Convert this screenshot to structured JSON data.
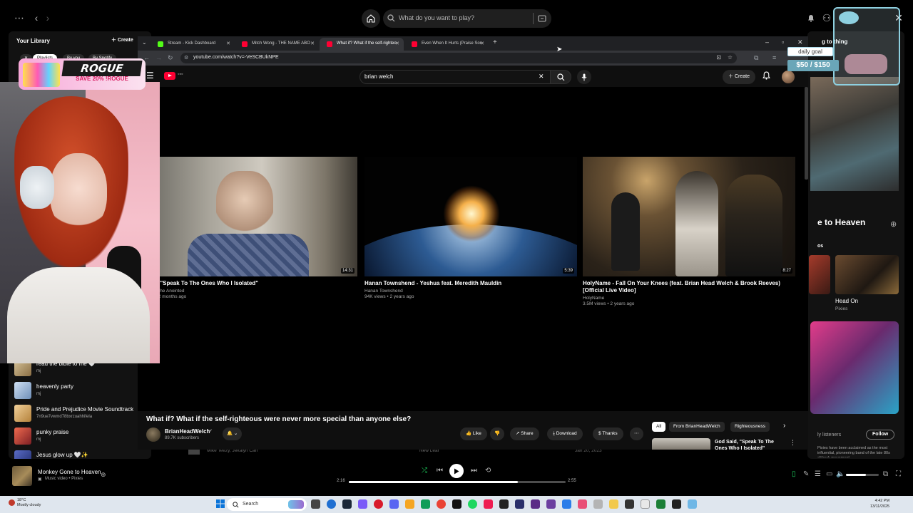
{
  "spotify": {
    "search_placeholder": "What do you want to play?",
    "library": {
      "title": "Your Library",
      "create_label": "Create",
      "chips": [
        "Playlists",
        "By you",
        "By Spotify"
      ],
      "items": [
        {
          "name": "read the bible to me 🤍",
          "sub": "mj"
        },
        {
          "name": "heavenly party",
          "sub": "mj"
        },
        {
          "name": "Pride and Prejudice Movie Soundtrack",
          "sub": "7n9ue7vwmd78bxrzuahhifela"
        },
        {
          "name": "punky praise",
          "sub": "mj"
        },
        {
          "name": "Jesus glow up 🤍✨",
          "sub": ""
        }
      ]
    },
    "right_panel": {
      "header_snippet": "g to thing",
      "song_title": "e to Heaven",
      "section_label": "os",
      "card_title": "Head On",
      "card_artist": "Pixies",
      "listeners_label": "ly listeners",
      "follow_label": "Follow",
      "bio": "Pixies have been acclaimed as the most influential, pioneering band of the late 80s alt/rock movement,"
    },
    "now_playing": {
      "title": "Monkey Gone to Heaven",
      "subtitle": "Music video • Pixies",
      "elapsed": "2:16",
      "duration": "2:55",
      "progress": 0.78,
      "volume": 0.6
    },
    "obscured_row": {
      "artists": "Mike Teezy, Jekalyn Carr",
      "album": "New Lear",
      "date": "Jan 20, 2023"
    }
  },
  "browser": {
    "tabs": [
      {
        "title": "Stream - Kick Dashboard",
        "active": false,
        "color": "#53fc18"
      },
      {
        "title": "Mitch Wong - THE NAME ABO",
        "active": false,
        "color": "#ff0033"
      },
      {
        "title": "What if? What if the self-righteo",
        "active": true,
        "color": "#ff0033"
      },
      {
        "title": "Even When It Hurts (Praise Son",
        "active": false,
        "color": "#ff0033"
      }
    ],
    "url": "youtube.com/watch?v=-VeSCBUkNPE"
  },
  "youtube": {
    "search_value": "brian welch",
    "create_label": "Create",
    "end_cards": [
      {
        "title": "Said, \"Speak To The Ones Who I Isolated\"",
        "channel": "ey Of The Anointed",
        "meta": "iews • 2 months ago",
        "duration": "14:31"
      },
      {
        "title": "Hanan Townshend - Yeshua feat. Meredith Mauldin",
        "channel": "Hanan Townshend",
        "meta": "94K views • 2 years ago",
        "duration": "5:39"
      },
      {
        "title": "HolyName - Fall On Your Knees (feat. Brian Head Welch & Brook Reeves) [Official Live Video]",
        "channel": "HolyName",
        "meta": "3.5M views • 2 years ago",
        "duration": "8:27"
      }
    ],
    "video_title": "What if? What if the self-righteous were never more special than anyone else?",
    "channel_name": "BrianHeadWelch",
    "subscribers": "89.7K subscribers",
    "actions": {
      "like": "Like",
      "share": "Share",
      "download": "Download",
      "thanks": "Thanks"
    },
    "chips": [
      "All",
      "From BrianHeadWelch",
      "Righteousness"
    ],
    "suggestion_title": "God Said, \"Speak To The Ones Who I Isolated\""
  },
  "overlay": {
    "sponsor_brand": "ROGUE",
    "sponsor_offer": "SAVE 20% !ROGUE",
    "goal_label": "daily goal",
    "goal_value": "$50 / $150"
  },
  "taskbar": {
    "weather_temp": "18°C",
    "weather_desc": "Mostly cloudy",
    "search_label": "Search",
    "time": "4:42 PM",
    "date": "13/11/2025"
  },
  "colors": {
    "spotify_green": "#1ed760",
    "youtube_red": "#ff0033",
    "chip_active": "#ffffff"
  }
}
